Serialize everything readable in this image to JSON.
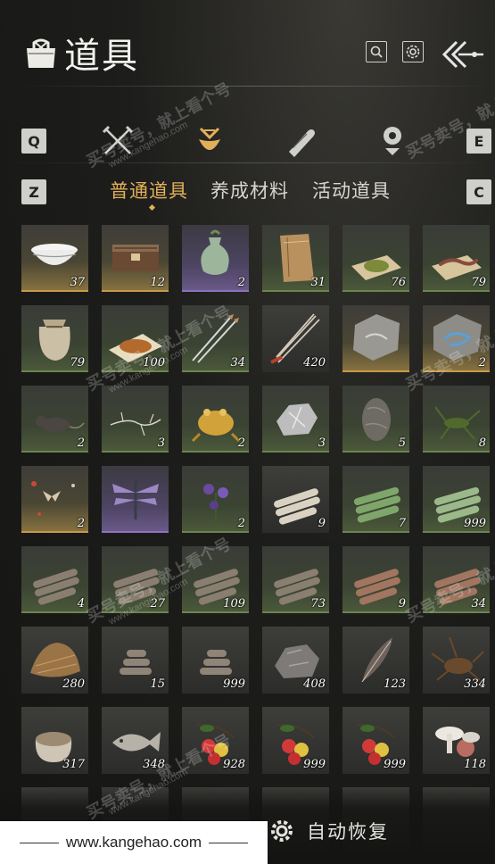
{
  "header": {
    "title": "道具",
    "icons": [
      "bag-icon",
      "search-icon",
      "settings-icon",
      "back-icon"
    ]
  },
  "category_tabs": {
    "left_key": "Q",
    "right_key": "E",
    "icons": [
      "crossed-swords-icon",
      "pouch-icon",
      "scroll-icon",
      "gem-icon"
    ],
    "active_index": 1
  },
  "sub_tabs": {
    "left_key": "Z",
    "right_key": "C",
    "items": [
      "普通道具",
      "养成材料",
      "活动道具"
    ],
    "active_index": 0
  },
  "items": [
    {
      "icon": "bowl-icon",
      "count": "37",
      "rarity": "gold"
    },
    {
      "icon": "chest-icon",
      "count": "12",
      "rarity": "gold"
    },
    {
      "icon": "vase-icon",
      "count": "2",
      "rarity": "purple"
    },
    {
      "icon": "paper-icon",
      "count": "31",
      "rarity": "green"
    },
    {
      "icon": "powder-icon",
      "count": "76",
      "rarity": "green"
    },
    {
      "icon": "worm-icon",
      "count": "79",
      "rarity": "green"
    },
    {
      "icon": "sack-icon",
      "count": "79",
      "rarity": "green"
    },
    {
      "icon": "grain-icon",
      "count": "100",
      "rarity": "green"
    },
    {
      "icon": "arrows-icon",
      "count": "34",
      "rarity": "green"
    },
    {
      "icon": "arrow-bundle-icon",
      "count": "420",
      "rarity": "none"
    },
    {
      "icon": "fossil-stone-icon",
      "count": "",
      "rarity": "gold"
    },
    {
      "icon": "blue-fossil-icon",
      "count": "2",
      "rarity": "gold"
    },
    {
      "icon": "rat-icon",
      "count": "2",
      "rarity": "green"
    },
    {
      "icon": "branch-icon",
      "count": "3",
      "rarity": "green"
    },
    {
      "icon": "toad-icon",
      "count": "2",
      "rarity": "green"
    },
    {
      "icon": "silver-ore-icon",
      "count": "3",
      "rarity": "green"
    },
    {
      "icon": "dark-stone-icon",
      "count": "5",
      "rarity": "green"
    },
    {
      "icon": "cricket-icon",
      "count": "8",
      "rarity": "green"
    },
    {
      "icon": "moths-icon",
      "count": "2",
      "rarity": "gold"
    },
    {
      "icon": "dragonfly-icon",
      "count": "",
      "rarity": "purple"
    },
    {
      "icon": "purple-flower-icon",
      "count": "2",
      "rarity": "green"
    },
    {
      "icon": "logs-light-icon",
      "count": "9",
      "rarity": "none"
    },
    {
      "icon": "bamboo-icon",
      "count": "7",
      "rarity": "green"
    },
    {
      "icon": "bamboo-bundle-icon",
      "count": "999",
      "rarity": "green"
    },
    {
      "icon": "logs-icon",
      "count": "4",
      "rarity": "green"
    },
    {
      "icon": "logs-icon",
      "count": "27",
      "rarity": "green"
    },
    {
      "icon": "logs-icon",
      "count": "109",
      "rarity": "green"
    },
    {
      "icon": "logs-icon",
      "count": "73",
      "rarity": "green"
    },
    {
      "icon": "logs-red-icon",
      "count": "9",
      "rarity": "green"
    },
    {
      "icon": "logs-red-icon",
      "count": "34",
      "rarity": "green"
    },
    {
      "icon": "straw-icon",
      "count": "280",
      "rarity": "none"
    },
    {
      "icon": "wood-pile-icon",
      "count": "15",
      "rarity": "none"
    },
    {
      "icon": "wood-pile-icon",
      "count": "999",
      "rarity": "none"
    },
    {
      "icon": "rock-icon",
      "count": "408",
      "rarity": "none"
    },
    {
      "icon": "feather-icon",
      "count": "123",
      "rarity": "none"
    },
    {
      "icon": "beetle-icon",
      "count": "334",
      "rarity": "none"
    },
    {
      "icon": "rice-sack-icon",
      "count": "317",
      "rarity": "none"
    },
    {
      "icon": "fish-icon",
      "count": "348",
      "rarity": "none"
    },
    {
      "icon": "berries-icon",
      "count": "928",
      "rarity": "none"
    },
    {
      "icon": "berries-icon",
      "count": "999",
      "rarity": "none"
    },
    {
      "icon": "berries-icon",
      "count": "999",
      "rarity": "none"
    },
    {
      "icon": "mushroom-icon",
      "count": "118",
      "rarity": "none"
    }
  ],
  "footer": {
    "site": "www.kangehao.com",
    "auto_recover_label": "自动恢复"
  },
  "watermarks": {
    "main": "买号卖号，就上看个号",
    "url": "www.kangehao.com",
    "badge": "看个号"
  }
}
